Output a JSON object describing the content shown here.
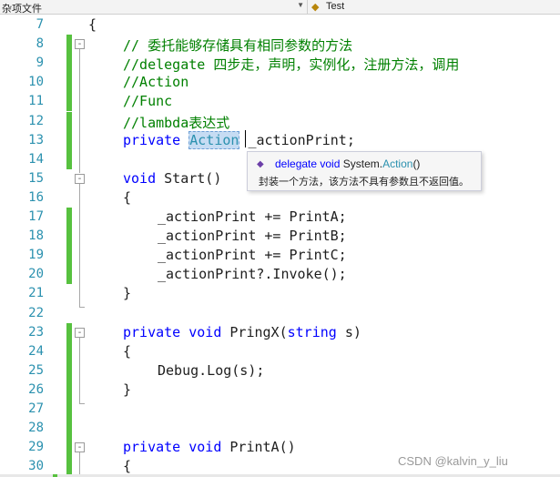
{
  "nav": {
    "left_label": "杂项文件",
    "right_label": "Test"
  },
  "editor": {
    "lines": [
      {
        "num": "7",
        "tokens": [
          {
            "c": "t-id",
            "t": "{"
          }
        ]
      },
      {
        "num": "8",
        "tokens": [
          {
            "c": "t-cmt",
            "t": "// 委托能够存储具有相同参数的方法"
          }
        ]
      },
      {
        "num": "9",
        "tokens": [
          {
            "c": "t-cmt",
            "t": "//delegate 四步走，声明，实例化，注册方法，调用"
          }
        ]
      },
      {
        "num": "10",
        "tokens": [
          {
            "c": "t-cmt",
            "t": "//Action"
          }
        ]
      },
      {
        "num": "11",
        "tokens": [
          {
            "c": "t-cmt",
            "t": "//Func"
          }
        ]
      },
      {
        "num": "12",
        "tokens": [
          {
            "c": "t-cmt",
            "t": "//lambda表达式"
          }
        ]
      },
      {
        "num": "13",
        "tokens": [
          {
            "c": "t-kw",
            "t": "private "
          },
          {
            "c": "t-sel",
            "t": "Action"
          },
          {
            "c": "t-id",
            "t": " _actionPrint;"
          }
        ]
      },
      {
        "num": "14",
        "tokens": []
      },
      {
        "num": "15",
        "tokens": [
          {
            "c": "t-kw",
            "t": "void "
          },
          {
            "c": "t-id",
            "t": "Start()"
          }
        ]
      },
      {
        "num": "16",
        "tokens": [
          {
            "c": "t-id",
            "t": "{"
          }
        ]
      },
      {
        "num": "17",
        "tokens": [
          {
            "c": "t-id",
            "t": "_actionPrint += PrintA;"
          }
        ]
      },
      {
        "num": "18",
        "tokens": [
          {
            "c": "t-id",
            "t": "_actionPrint += PrintB;"
          }
        ]
      },
      {
        "num": "19",
        "tokens": [
          {
            "c": "t-id",
            "t": "_actionPrint += PrintC;"
          }
        ]
      },
      {
        "num": "20",
        "tokens": [
          {
            "c": "t-id",
            "t": "_actionPrint?.Invoke();"
          }
        ]
      },
      {
        "num": "21",
        "tokens": [
          {
            "c": "t-id",
            "t": "}"
          }
        ]
      },
      {
        "num": "22",
        "tokens": []
      },
      {
        "num": "23",
        "tokens": [
          {
            "c": "t-kw",
            "t": "private void "
          },
          {
            "c": "t-id",
            "t": "PringX("
          },
          {
            "c": "t-kw",
            "t": "string "
          },
          {
            "c": "t-id",
            "t": "s)"
          }
        ]
      },
      {
        "num": "24",
        "tokens": [
          {
            "c": "t-id",
            "t": "{"
          }
        ]
      },
      {
        "num": "25",
        "tokens": [
          {
            "c": "t-id",
            "t": "Debug.Log(s);"
          }
        ]
      },
      {
        "num": "26",
        "tokens": [
          {
            "c": "t-id",
            "t": "}"
          }
        ]
      },
      {
        "num": "27",
        "tokens": []
      },
      {
        "num": "28",
        "tokens": []
      },
      {
        "num": "29",
        "tokens": [
          {
            "c": "t-kw",
            "t": "private void "
          },
          {
            "c": "t-id",
            "t": "PrintA()"
          }
        ]
      },
      {
        "num": "30",
        "tokens": [
          {
            "c": "t-id",
            "t": "{"
          }
        ]
      }
    ]
  },
  "tooltip": {
    "keyword": "delegate void",
    "ns": "System.",
    "type": "Action",
    "parens": "()",
    "description": "封装一个方法，该方法不具有参数且不返回值。"
  },
  "watermark": "CSDN @kalvin_y_liu"
}
